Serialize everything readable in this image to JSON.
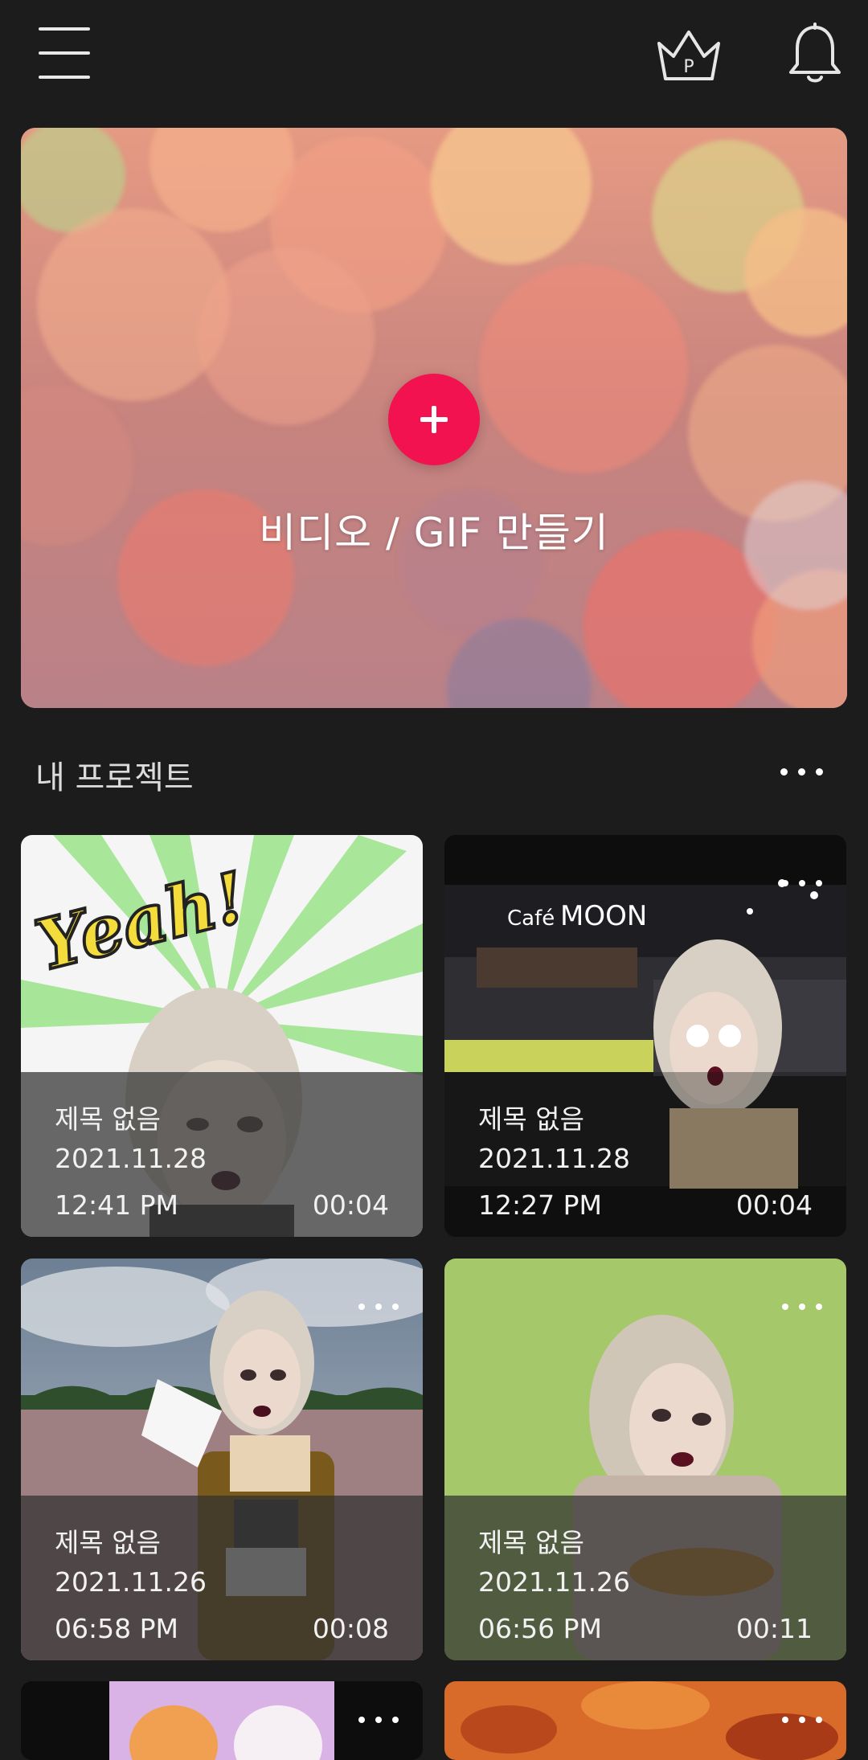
{
  "header": {
    "menu_icon": "hamburger-menu-icon",
    "premium_icon": "crown-premium-icon",
    "premium_badge_letter": "P",
    "notifications_icon": "bell-icon"
  },
  "hero": {
    "label": "비디오 / GIF 만들기",
    "plus_icon": "plus-icon",
    "accent_color": "#f2124f"
  },
  "section": {
    "title": "내 프로젝트",
    "more_icon": "more-dots-icon"
  },
  "projects": [
    {
      "title": "제목 없음",
      "date": "2021.11.28",
      "time": "12:41 PM",
      "duration": "00:04"
    },
    {
      "title": "제목 없음",
      "date": "2021.11.28",
      "time": "12:27 PM",
      "duration": "00:04"
    },
    {
      "title": "제목 없음",
      "date": "2021.11.26",
      "time": "06:58 PM",
      "duration": "00:08"
    },
    {
      "title": "제목 없음",
      "date": "2021.11.26",
      "time": "06:56 PM",
      "duration": "00:11"
    }
  ],
  "thumbnail_texts": {
    "yeah_sticker": "Yeah!",
    "cafe_sign_prefix": "Café",
    "cafe_sign_name": "MOON"
  },
  "colors": {
    "background": "#1c1c1c",
    "card_overlay": "#303030"
  }
}
